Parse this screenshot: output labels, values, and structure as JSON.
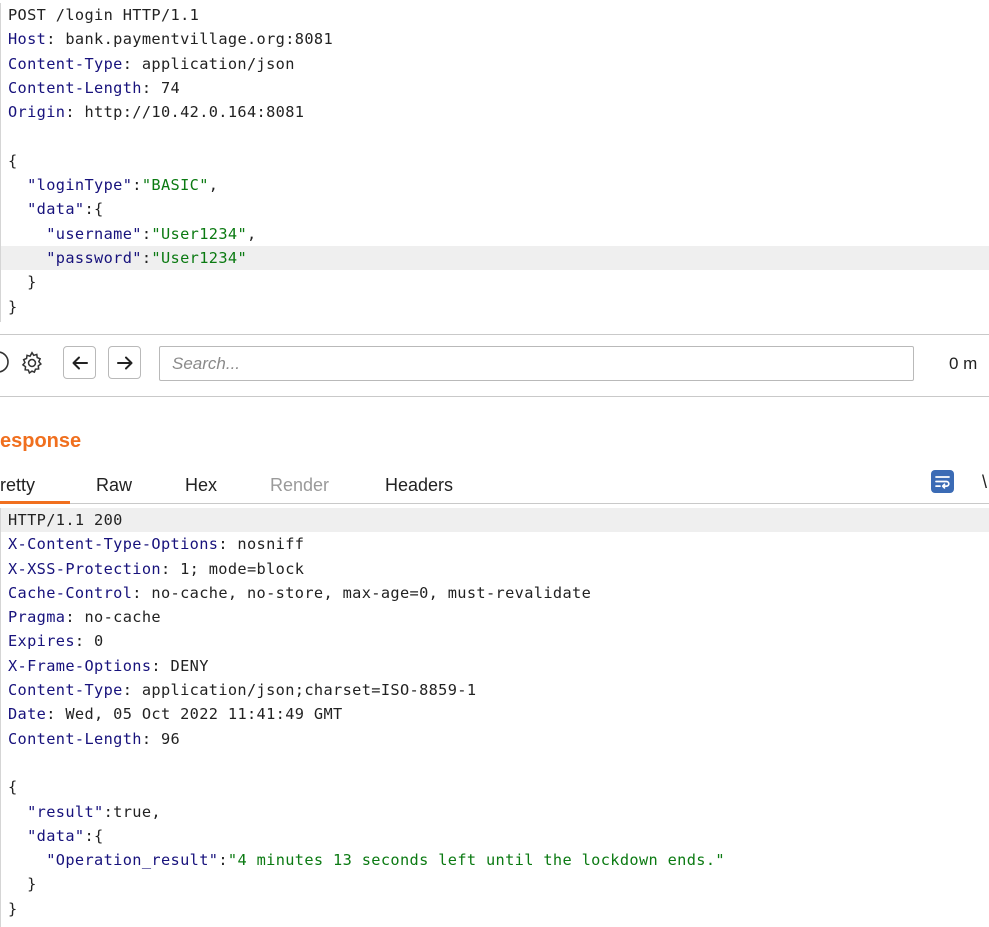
{
  "request": {
    "lines": [
      [
        {
          "t": "POST /login HTTP/1.1",
          "c": "pn"
        }
      ],
      [
        {
          "t": "Host",
          "c": "hk"
        },
        {
          "t": ": bank.paymentvillage.org:8081",
          "c": "pn"
        }
      ],
      [
        {
          "t": "Content-Type",
          "c": "hk"
        },
        {
          "t": ": application/json",
          "c": "pn"
        }
      ],
      [
        {
          "t": "Content-Length",
          "c": "hk"
        },
        {
          "t": ": 74",
          "c": "pn"
        }
      ],
      [
        {
          "t": "Origin",
          "c": "hk"
        },
        {
          "t": ": http://10.42.0.164:8081",
          "c": "pn"
        }
      ],
      [
        {
          "t": "",
          "c": "pn"
        }
      ],
      [
        {
          "t": "{",
          "c": "pn"
        }
      ],
      [
        {
          "t": "  ",
          "c": "pn"
        },
        {
          "t": "\"loginType\"",
          "c": "jk"
        },
        {
          "t": ":",
          "c": "pn"
        },
        {
          "t": "\"BASIC\"",
          "c": "jv"
        },
        {
          "t": ",",
          "c": "pn"
        }
      ],
      [
        {
          "t": "  ",
          "c": "pn"
        },
        {
          "t": "\"data\"",
          "c": "jk"
        },
        {
          "t": ":{",
          "c": "pn"
        }
      ],
      [
        {
          "t": "    ",
          "c": "pn"
        },
        {
          "t": "\"username\"",
          "c": "jk"
        },
        {
          "t": ":",
          "c": "pn"
        },
        {
          "t": "\"User1234\"",
          "c": "jv"
        },
        {
          "t": ",",
          "c": "pn"
        }
      ],
      [
        {
          "t": "    ",
          "c": "pn"
        },
        {
          "t": "\"password\"",
          "c": "jk"
        },
        {
          "t": ":",
          "c": "pn"
        },
        {
          "t": "\"User1234\"",
          "c": "jv"
        }
      ],
      [
        {
          "t": "  }",
          "c": "pn"
        }
      ],
      [
        {
          "t": "}",
          "c": "pn"
        }
      ]
    ],
    "highlighted_line": 10
  },
  "toolbar": {
    "search_placeholder": "Search...",
    "matches": "0 m",
    "help_icon": "help-circle-icon",
    "settings_icon": "gear-icon",
    "back_icon": "arrow-left-icon",
    "forward_icon": "arrow-right-icon"
  },
  "response": {
    "title": "esponse",
    "tabs": [
      {
        "label": "retty",
        "state": "active"
      },
      {
        "label": "Raw",
        "state": "normal"
      },
      {
        "label": "Hex",
        "state": "normal"
      },
      {
        "label": "Render",
        "state": "disabled"
      },
      {
        "label": "Headers",
        "state": "normal"
      }
    ],
    "wrap_label": "\\",
    "wrap_icon": "word-wrap-icon",
    "lines": [
      [
        {
          "t": "HTTP/1.1 200",
          "c": "pn"
        }
      ],
      [
        {
          "t": "X-Content-Type-Options",
          "c": "hk"
        },
        {
          "t": ": nosniff",
          "c": "pn"
        }
      ],
      [
        {
          "t": "X-XSS-Protection",
          "c": "hk"
        },
        {
          "t": ": 1; mode=block",
          "c": "pn"
        }
      ],
      [
        {
          "t": "Cache-Control",
          "c": "hk"
        },
        {
          "t": ": no-cache, no-store, max-age=0, must-revalidate",
          "c": "pn"
        }
      ],
      [
        {
          "t": "Pragma",
          "c": "hk"
        },
        {
          "t": ": no-cache",
          "c": "pn"
        }
      ],
      [
        {
          "t": "Expires",
          "c": "hk"
        },
        {
          "t": ": 0",
          "c": "pn"
        }
      ],
      [
        {
          "t": "X-Frame-Options",
          "c": "hk"
        },
        {
          "t": ": DENY",
          "c": "pn"
        }
      ],
      [
        {
          "t": "Content-Type",
          "c": "hk"
        },
        {
          "t": ": application/json;charset=ISO-8859-1",
          "c": "pn"
        }
      ],
      [
        {
          "t": "Date",
          "c": "hk"
        },
        {
          "t": ": Wed, 05 Oct 2022 11:41:49 GMT",
          "c": "pn"
        }
      ],
      [
        {
          "t": "Content-Length",
          "c": "hk"
        },
        {
          "t": ": 96",
          "c": "pn"
        }
      ],
      [
        {
          "t": "",
          "c": "pn"
        }
      ],
      [
        {
          "t": "{",
          "c": "pn"
        }
      ],
      [
        {
          "t": "  ",
          "c": "pn"
        },
        {
          "t": "\"result\"",
          "c": "jk"
        },
        {
          "t": ":true,",
          "c": "pn"
        }
      ],
      [
        {
          "t": "  ",
          "c": "pn"
        },
        {
          "t": "\"data\"",
          "c": "jk"
        },
        {
          "t": ":{",
          "c": "pn"
        }
      ],
      [
        {
          "t": "    ",
          "c": "pn"
        },
        {
          "t": "\"Operation_result\"",
          "c": "jk"
        },
        {
          "t": ":",
          "c": "pn"
        },
        {
          "t": "\"4 minutes 13 seconds left until the lockdown ends.\"",
          "c": "jv"
        }
      ],
      [
        {
          "t": "  }",
          "c": "pn"
        }
      ],
      [
        {
          "t": "}",
          "c": "pn"
        }
      ]
    ],
    "highlighted_line": 0
  },
  "colors": {
    "accent": "#f06f1e",
    "header_key": "#17127c",
    "json_string": "#0b7a12",
    "line_highlight": "#efefef"
  }
}
